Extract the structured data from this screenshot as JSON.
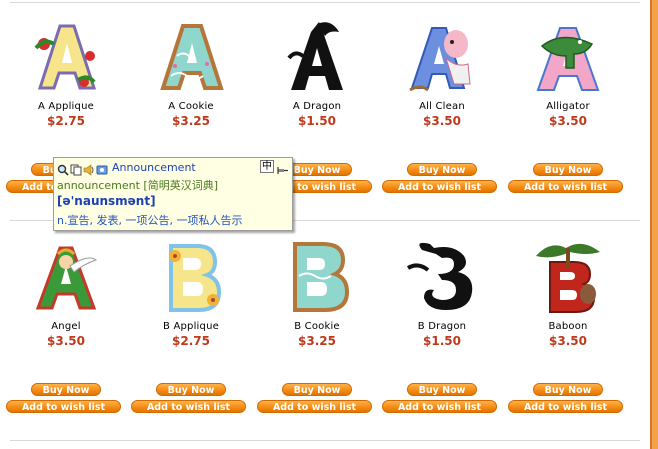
{
  "products": [
    {
      "name": "A Applique",
      "price": "$2.75"
    },
    {
      "name": "A Cookie",
      "price": "$3.25"
    },
    {
      "name": "A Dragon",
      "price": "$1.50"
    },
    {
      "name": "All Clean",
      "price": "$3.50"
    },
    {
      "name": "Alligator",
      "price": "$3.50"
    },
    {
      "name": "Angel",
      "price": "$3.50"
    },
    {
      "name": "B Applique",
      "price": "$2.75"
    },
    {
      "name": "B Cookie",
      "price": "$3.25"
    },
    {
      "name": "B Dragon",
      "price": "$1.50"
    },
    {
      "name": "Baboon",
      "price": "$3.50"
    }
  ],
  "buttons": {
    "buy": "Buy Now",
    "wish": "Add to wish list"
  },
  "popup": {
    "title": "Announcement",
    "lang_toggle": "中",
    "word_line": "announcement [简明英汉词典]",
    "phonetic": "[ə'naunsmənt]",
    "definition": "n.宣告, 发表, 一项公告, 一项私人告示"
  },
  "colors": {
    "price": "#c0391b",
    "button": "#f28a12",
    "popup_bg": "#ffffe3",
    "frame": "#f3a24a"
  }
}
